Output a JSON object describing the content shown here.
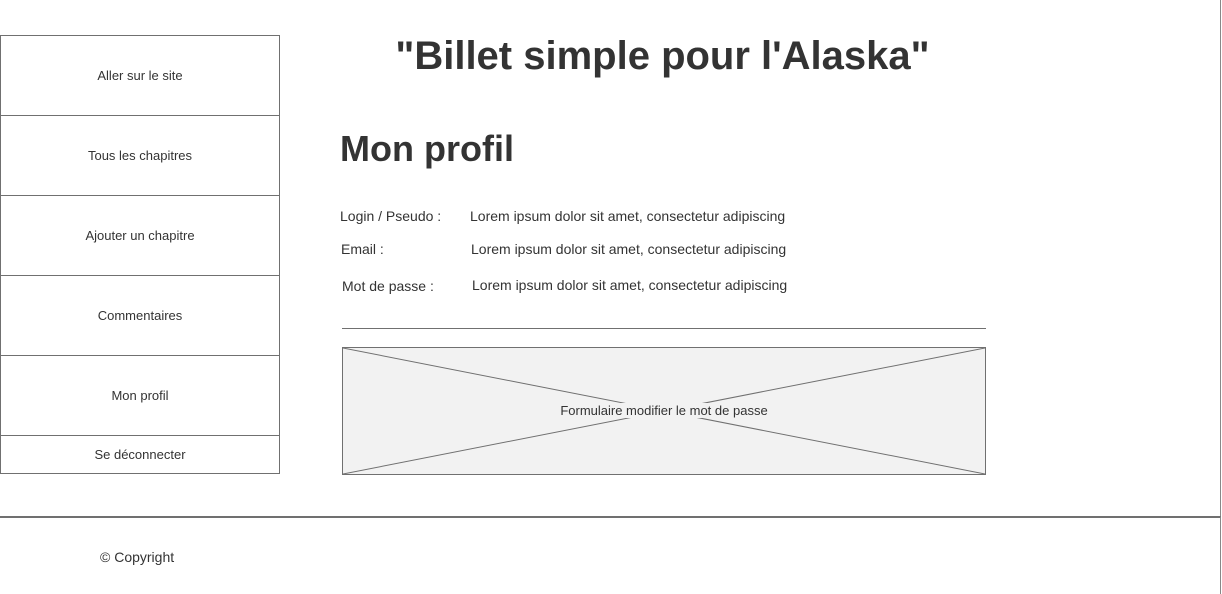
{
  "site_title": "\"Billet simple pour l'Alaska\"",
  "sidebar": {
    "items": [
      {
        "label": "Aller sur le site"
      },
      {
        "label": "Tous les chapitres"
      },
      {
        "label": "Ajouter un chapitre"
      },
      {
        "label": "Commentaires"
      },
      {
        "label": "Mon profil"
      },
      {
        "label": "Se déconnecter"
      }
    ]
  },
  "main": {
    "heading": "Mon profil",
    "fields": [
      {
        "label": "Login / Pseudo :",
        "value": "Lorem ipsum dolor sit amet, consectetur adipiscing"
      },
      {
        "label": "Email :",
        "value": "Lorem ipsum dolor sit amet, consectetur adipiscing"
      },
      {
        "label": "Mot de passe :",
        "value": "Lorem ipsum dolor sit amet, consectetur adipiscing"
      }
    ],
    "form_placeholder": "Formulaire modifier le mot de passe"
  },
  "footer": {
    "copyright": "© Copyright"
  }
}
